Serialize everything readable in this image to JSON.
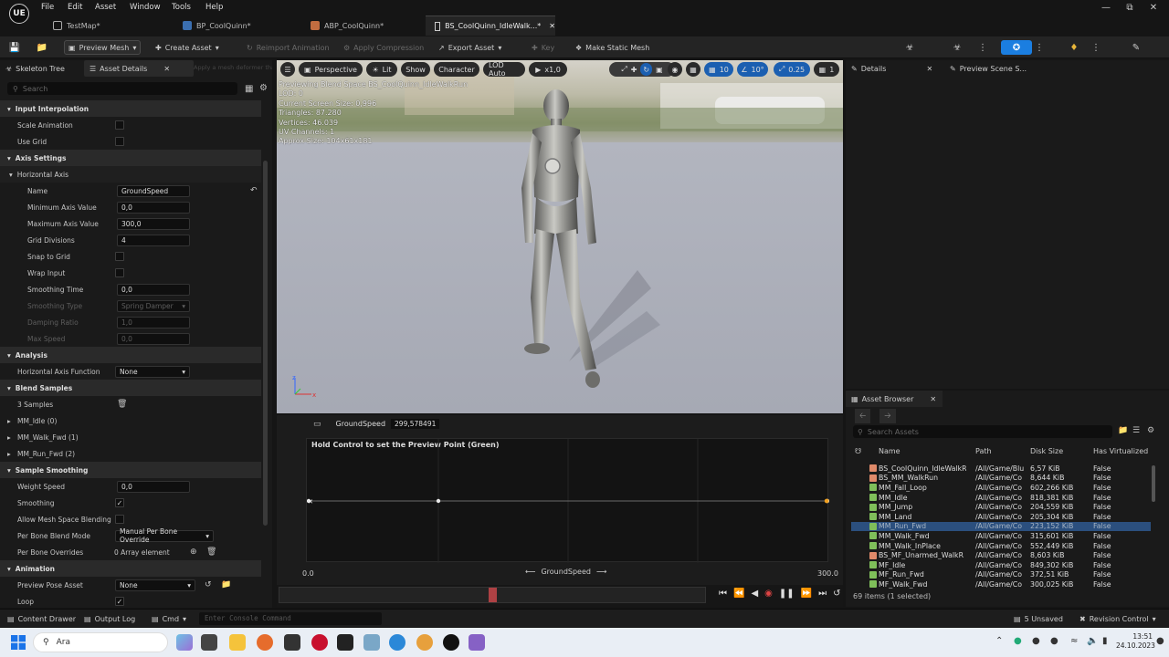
{
  "menubar": {
    "items": [
      "File",
      "Edit",
      "Asset",
      "Window",
      "Tools",
      "Help"
    ],
    "logo": "UE"
  },
  "tabs": [
    {
      "label": "TestMap*",
      "icon": "level-icon"
    },
    {
      "label": "BP_CoolQuinn*",
      "icon": "blueprint-icon"
    },
    {
      "label": "ABP_CoolQuinn*",
      "icon": "anim-blueprint-icon"
    },
    {
      "label": "BS_CoolQuinn_IdleWalk...*",
      "icon": "blendspace-icon",
      "active": true
    }
  ],
  "toolbar": {
    "preview_mesh": "Preview Mesh",
    "create_asset": "Create Asset",
    "reimport": "Reimport Animation",
    "apply_compression": "Apply Compression",
    "export_asset": "Export Asset",
    "key": "Key",
    "make_static_mesh": "Make Static Mesh"
  },
  "left_panel": {
    "tab_skeleton": "Skeleton Tree",
    "tab_asset_details": "Asset Details",
    "tooltip": "Apply a mesh deformer that ... for the current asset ...",
    "search_placeholder": "Search",
    "sections": {
      "input_interp": "Input Interpolation",
      "axis_settings": "Axis Settings",
      "horizontal_axis": "Horizontal Axis",
      "analysis": "Analysis",
      "blend_samples": "Blend Samples",
      "sample_smoothing": "Sample Smoothing",
      "animation": "Animation"
    },
    "props": {
      "scale_animation": "Scale Animation",
      "use_grid": "Use Grid",
      "name": "Name",
      "name_value": "GroundSpeed",
      "min_axis": "Minimum Axis Value",
      "min_axis_value": "0,0",
      "max_axis": "Maximum Axis Value",
      "max_axis_value": "300,0",
      "grid_divisions": "Grid Divisions",
      "grid_divisions_value": "4",
      "snap_to_grid": "Snap to Grid",
      "wrap_input": "Wrap Input",
      "smoothing_time": "Smoothing Time",
      "smoothing_time_value": "0,0",
      "smoothing_type": "Smoothing Type",
      "smoothing_type_value": "Spring Damper",
      "damping_ratio": "Damping Ratio",
      "damping_ratio_value": "1,0",
      "max_speed": "Max Speed",
      "max_speed_value": "0,0",
      "h_axis_function": "Horizontal Axis Function",
      "h_axis_function_value": "None",
      "samples_count": "3 Samples",
      "sample_0": "MM_Idle (0)",
      "sample_1": "MM_Walk_Fwd (1)",
      "sample_2": "MM_Run_Fwd (2)",
      "weight_speed": "Weight Speed",
      "weight_speed_value": "0,0",
      "smoothing": "Smoothing",
      "allow_mesh_space": "Allow Mesh Space Blending",
      "per_bone_mode": "Per Bone Blend Mode",
      "per_bone_mode_value": "Manual Per Bone Override",
      "per_bone_overrides": "Per Bone Overrides",
      "per_bone_overrides_value": "0 Array element",
      "preview_pose": "Preview Pose Asset",
      "preview_pose_value": "None",
      "loop": "Loop"
    }
  },
  "viewport": {
    "perspective": "Perspective",
    "lit": "Lit",
    "show": "Show",
    "character": "Character",
    "lod": "LOD Auto",
    "play_rate": "x1,0",
    "grid_size": "10",
    "rotation_snap": "10°",
    "scale_snap": "0.25",
    "camera_speed": "1",
    "stats": [
      "Previewing Blend Space BS_CoolQuinn_IdleWalkRun",
      "LOD: 0",
      "Current Screen Size: 0,996",
      "Triangles: 87.280",
      "Vertices: 46.039",
      "UV Channels: 1",
      "Approx Size: 104x61x181"
    ]
  },
  "blendspace": {
    "param_label": "GroundSpeed",
    "param_value": "299,578491",
    "hint": "Hold Control to set the Preview Point (Green)",
    "axis_min": "0.0",
    "axis_max": "300.0",
    "axis_label": "GroundSpeed",
    "samples": [
      0,
      75,
      300
    ],
    "preview_point": 299.58,
    "playhead": 0.5
  },
  "right_panel": {
    "tab_details": "Details",
    "tab_preview_scene": "Preview Scene S..."
  },
  "asset_browser": {
    "title": "Asset Browser",
    "search_placeholder": "Search Assets",
    "columns": [
      "Name",
      "Path",
      "Disk Size",
      "Has Virtualized D"
    ],
    "rows": [
      {
        "name": "BS_CoolQuinn_IdleWalkR",
        "path": "/All/Game/Blu",
        "size": "6,57 KiB",
        "virt": "False",
        "color": "#e08a6a"
      },
      {
        "name": "BS_MM_WalkRun",
        "path": "/All/Game/Co",
        "size": "8,644 KiB",
        "virt": "False",
        "color": "#e08a6a"
      },
      {
        "name": "MM_Fall_Loop",
        "path": "/All/Game/Co",
        "size": "602,266 KiB",
        "virt": "False",
        "color": "#7fbf5a"
      },
      {
        "name": "MM_Idle",
        "path": "/All/Game/Co",
        "size": "818,381 KiB",
        "virt": "False",
        "color": "#7fbf5a"
      },
      {
        "name": "MM_Jump",
        "path": "/All/Game/Co",
        "size": "204,559 KiB",
        "virt": "False",
        "color": "#7fbf5a"
      },
      {
        "name": "MM_Land",
        "path": "/All/Game/Co",
        "size": "205,304 KiB",
        "virt": "False",
        "color": "#7fbf5a"
      },
      {
        "name": "MM_Run_Fwd",
        "path": "/All/Game/Co",
        "size": "223,152 KiB",
        "virt": "False",
        "color": "#7fbf5a",
        "selected": true
      },
      {
        "name": "MM_Walk_Fwd",
        "path": "/All/Game/Co",
        "size": "315,601 KiB",
        "virt": "False",
        "color": "#7fbf5a"
      },
      {
        "name": "MM_Walk_InPlace",
        "path": "/All/Game/Co",
        "size": "552,449 KiB",
        "virt": "False",
        "color": "#7fbf5a"
      },
      {
        "name": "BS_MF_Unarmed_WalkR",
        "path": "/All/Game/Co",
        "size": "8,603 KiB",
        "virt": "False",
        "color": "#e08a6a"
      },
      {
        "name": "MF_Idle",
        "path": "/All/Game/Co",
        "size": "849,302 KiB",
        "virt": "False",
        "color": "#7fbf5a"
      },
      {
        "name": "MF_Run_Fwd",
        "path": "/All/Game/Co",
        "size": "372,51 KiB",
        "virt": "False",
        "color": "#7fbf5a"
      },
      {
        "name": "MF_Walk_Fwd",
        "path": "/All/Game/Co",
        "size": "300,025 KiB",
        "virt": "False",
        "color": "#7fbf5a"
      }
    ],
    "footer": "69 items (1 selected)"
  },
  "statusbar": {
    "content_drawer": "Content Drawer",
    "output_log": "Output Log",
    "cmd": "Cmd",
    "console_placeholder": "Enter Console Command",
    "unsaved": "5 Unsaved",
    "revision": "Revision Control"
  },
  "taskbar": {
    "search": "Ara",
    "time": "13:51",
    "date": "24.10.2023"
  }
}
